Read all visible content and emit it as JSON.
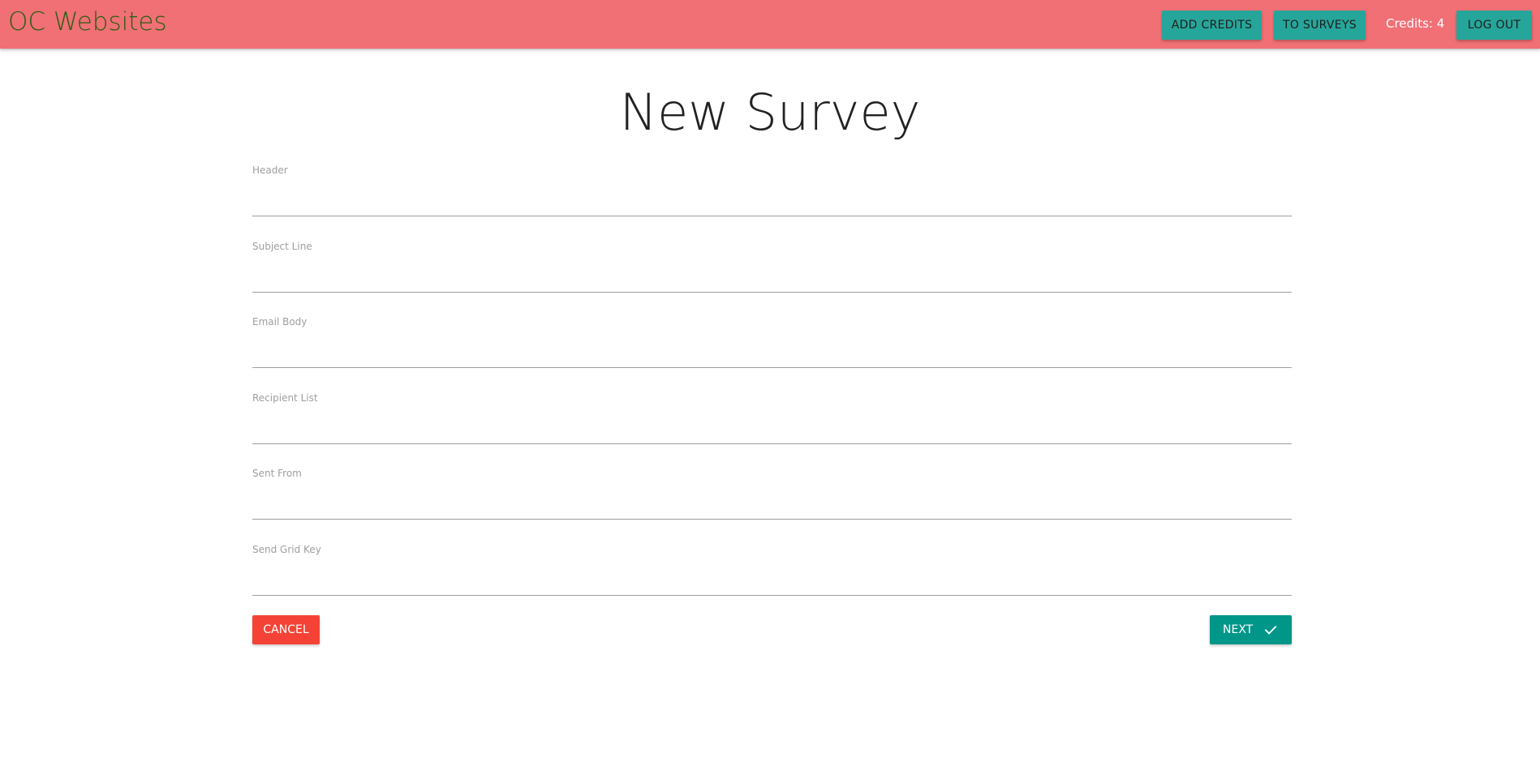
{
  "navbar": {
    "brand": "OC Websites",
    "add_credits_label": "ADD CREDITS",
    "to_surveys_label": "TO SURVEYS",
    "credits_text": "Credits: 4",
    "logout_label": "LOG OUT"
  },
  "page": {
    "title": "New Survey"
  },
  "form": {
    "fields": [
      {
        "label": "Header",
        "value": ""
      },
      {
        "label": "Subject Line",
        "value": ""
      },
      {
        "label": "Email Body",
        "value": ""
      },
      {
        "label": "Recipient List",
        "value": ""
      },
      {
        "label": "Sent From",
        "value": ""
      },
      {
        "label": "Send Grid Key",
        "value": ""
      }
    ],
    "cancel_label": "CANCEL",
    "next_label": "NEXT",
    "next_icon": "check-icon"
  },
  "colors": {
    "navbar_bg": "#f07075",
    "brand_text": "#2e5c14",
    "nav_button_bg": "#26a69a",
    "cancel_bg": "#f44336",
    "next_bg": "#009688"
  }
}
